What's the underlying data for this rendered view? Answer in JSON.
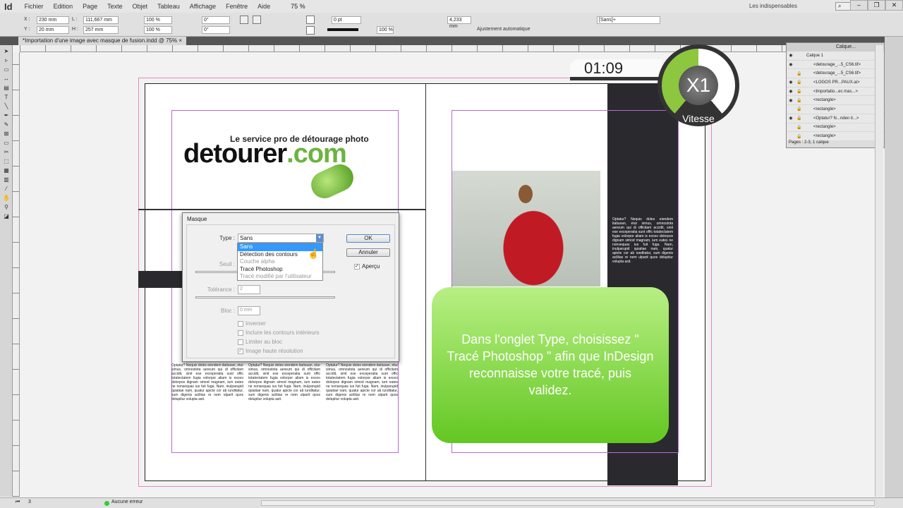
{
  "app": {
    "logo": "Id",
    "menu": [
      "Fichier",
      "Edition",
      "Page",
      "Texte",
      "Objet",
      "Tableau",
      "Affichage",
      "Fenêtre",
      "Aide"
    ],
    "zoom": "75 %",
    "workspace": "Les indispensables",
    "window_buttons": [
      "–",
      "❐",
      "✕"
    ]
  },
  "control": {
    "x": "230 mm",
    "y": "20 mm",
    "w": "111,667 mm",
    "h": "257 mm",
    "scale_x": "100 %",
    "scale_y": "100 %",
    "rotate": "0°",
    "shear": "0°",
    "stroke": "0 pt",
    "opacity": "100 %",
    "offset": "4,233 mm",
    "autofit": "Ajustement automatique",
    "style": "[Sans]+",
    "labels": {
      "x": "X :",
      "y": "Y :",
      "w": "L :",
      "h": "H :"
    }
  },
  "document": {
    "tab": "*Importation d'une image avec masque de fusion.indd @ 75%",
    "close": "×"
  },
  "page": {
    "logo_tagline": "Le service pro de détourage photo",
    "logo_main": "detourer",
    "logo_ext": ".com",
    "body_text": "Optatur? Nequis doles eiendem itatiusan, etur simus, omnostota aereum qui di officitam accidit, sinit ese exceperatia sunt offic totatectatem fugia volorpor aliam is exceo dolorpos dignam simod magnam, ium eates ne nonsequas ius fuit fuga. Nam, inulparupid quiatiae nam, quatur apicte cor ab iunditatur, sum digenis acilitas re nem ulparit quos dolupitur volupta asit."
  },
  "dialog": {
    "title": "Masque",
    "type_label": "Type :",
    "type_value": "Sans",
    "options": [
      "Sans",
      "Détection des contours",
      "Couche alpha",
      "Tracé Photoshop",
      "Tracé modifié par l'utilisateur"
    ],
    "seuil_label": "Seuil :",
    "tolerance_label": "Tolérance :",
    "tolerance_value": "2",
    "bloc_label": "Bloc :",
    "bloc_value": "0 mm",
    "checkboxes": [
      "Inverser",
      "Inclure les contours intérieurs",
      "Limiter au bloc",
      "Image haute résolution"
    ],
    "ok": "OK",
    "cancel": "Annuler",
    "preview": "Aperçu"
  },
  "overlay": {
    "timer": "01:09",
    "speed": "X1",
    "speed_label": "Vitesse",
    "speed_fraction": 0.4,
    "callout": "Dans l'onglet Type, choisissez \" Tracé Photoshop \" afin que InDesign reconnaisse votre tracé, puis validez."
  },
  "layers": {
    "tab": "Calque...",
    "items": [
      "Calque 1",
      "<detourage_...5_CS6.tif>",
      "<detourage_...5_CS6.tif>",
      "<LOGOS PR...PAUX.ai>",
      "<Importatio...ec mas...>",
      "<rectangle>",
      "<rectangle>",
      "<Optatur? N...nden it...>",
      "<rectangle>",
      "<rectangle>"
    ],
    "footer": "Pages : 2-3, 1 calque"
  },
  "status": {
    "page": "3",
    "errors": "Aucune erreur"
  }
}
